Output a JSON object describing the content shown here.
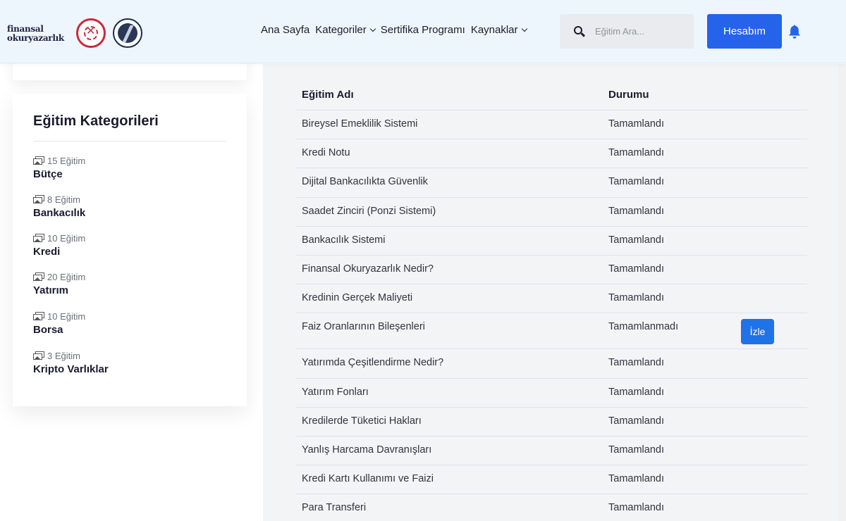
{
  "brand": {
    "logo_text": "finansal okuryazarlık",
    "seal_1": "ministry-seal",
    "seal_2": "institution-seal",
    "colors": {
      "seal_red": "#c92a3a",
      "seal_navy": "#1f2a4a"
    }
  },
  "nav": {
    "home": "Ana Sayfa",
    "categories": "Kategoriler",
    "certificate": "Sertifika Programı",
    "resources": "Kaynaklar"
  },
  "search": {
    "placeholder": "Eğitim Ara..."
  },
  "account": {
    "label": "Hesabım"
  },
  "colors": {
    "primary": "#2563eb",
    "watch_button": "#1e73e8",
    "header_bg": "#eef6fd",
    "content_bg": "#f3f4f6"
  },
  "sidebar": {
    "title": "Eğitim Kategorileri",
    "categories": [
      {
        "count": "15 Eğitim",
        "name": "Bütçe"
      },
      {
        "count": "8 Eğitim",
        "name": "Bankacılık"
      },
      {
        "count": "10 Eğitim",
        "name": "Kredi"
      },
      {
        "count": "20 Eğitim",
        "name": "Yatırım"
      },
      {
        "count": "10 Eğitim",
        "name": "Borsa"
      },
      {
        "count": "3 Eğitim",
        "name": "Kripto Varlıklar"
      }
    ]
  },
  "table": {
    "headers": {
      "name": "Eğitim Adı",
      "status": "Durumu"
    },
    "rows": [
      {
        "name": "Bireysel Emeklilik Sistemi",
        "status": "Tamamlandı"
      },
      {
        "name": "Kredi Notu",
        "status": "Tamamlandı"
      },
      {
        "name": "Dijital Bankacılıkta Güvenlik",
        "status": "Tamamlandı"
      },
      {
        "name": "Saadet Zinciri (Ponzi Sistemi)",
        "status": "Tamamlandı"
      },
      {
        "name": "Bankacılık Sistemi",
        "status": "Tamamlandı"
      },
      {
        "name": "Finansal Okuryazarlık Nedir?",
        "status": "Tamamlandı"
      },
      {
        "name": "Kredinin Gerçek Maliyeti",
        "status": "Tamamlandı"
      },
      {
        "name": "Faiz Oranlarının Bileşenleri",
        "status": "Tamamlanmadı",
        "action": "İzle"
      },
      {
        "name": "Yatırımda Çeşitlendirme Nedir?",
        "status": "Tamamlandı"
      },
      {
        "name": "Yatırım Fonları",
        "status": "Tamamlandı"
      },
      {
        "name": "Kredilerde Tüketici Hakları",
        "status": "Tamamlandı"
      },
      {
        "name": "Yanlış Harcama Davranışları",
        "status": "Tamamlandı"
      },
      {
        "name": "Kredi Kartı Kullanımı ve Faizi",
        "status": "Tamamlandı"
      },
      {
        "name": "Para Transferi",
        "status": "Tamamlandı"
      }
    ]
  }
}
